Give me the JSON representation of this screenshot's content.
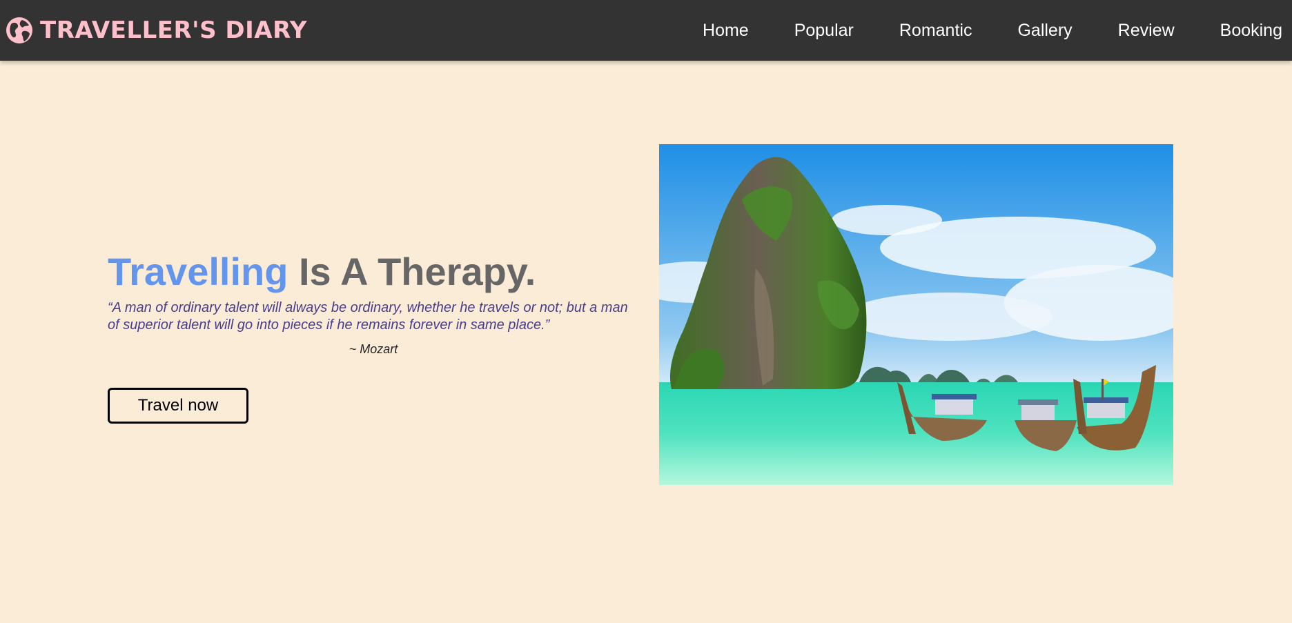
{
  "brand": {
    "name": "TRAVELLER'S DIARY",
    "icon": "globe-icon"
  },
  "nav": {
    "items": [
      {
        "label": "Home"
      },
      {
        "label": "Popular"
      },
      {
        "label": "Romantic"
      },
      {
        "label": "Gallery"
      },
      {
        "label": "Review"
      },
      {
        "label": "Booking"
      }
    ]
  },
  "hero": {
    "headline_accent": "Travelling",
    "headline_rest": " Is A Therapy.",
    "quote": "“A man of ordinary talent will always be ordinary, whether he travels or not; but a man of superior talent will go into pieces if he remains forever in same place.”",
    "author": "~ Mozart",
    "cta_label": "Travel now"
  },
  "colors": {
    "background": "#fbecd8",
    "navbar": "#333333",
    "brand": "#ffc0cb",
    "accent": "#6495ed",
    "headline": "#666666",
    "quote": "#483d8b"
  }
}
